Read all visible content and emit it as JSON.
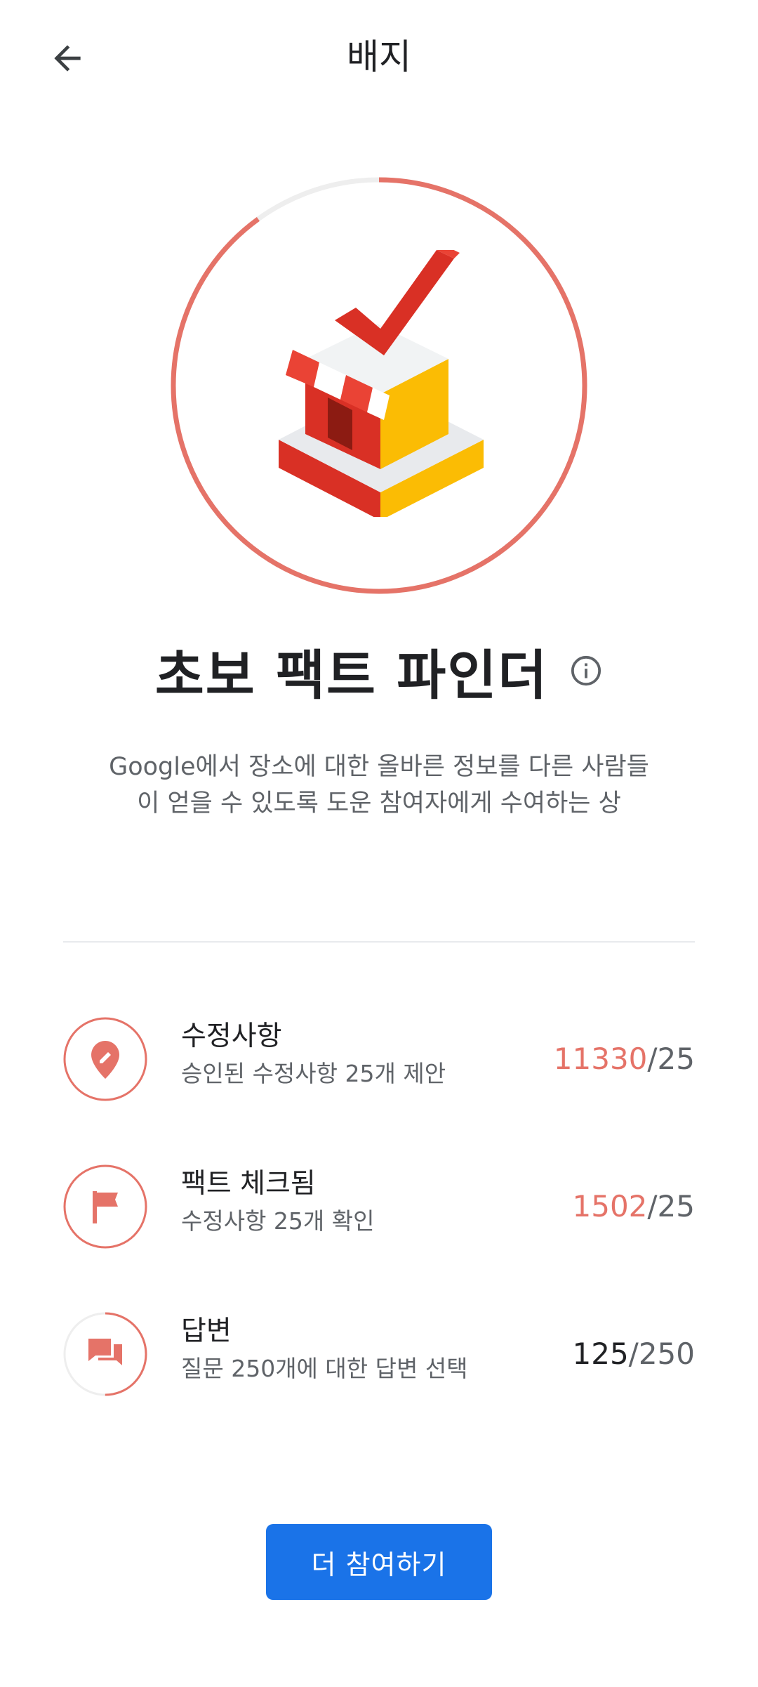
{
  "appbar": {
    "title": "배지",
    "back_icon": "arrow-back-icon"
  },
  "badge": {
    "name": "초보 팩트 파인더",
    "info_icon": "info-icon",
    "description": "Google에서 장소에 대한 올바른 정보를 다른 사람들이 얻을 수 있도록 도운 참여자에게 수여하는 상",
    "progress_fraction": 0.9,
    "ring_color": "#e57368",
    "ring_track_color": "#eeeeee"
  },
  "requirements": [
    {
      "icon": "pencil-pin-icon",
      "title": "수정사항",
      "subtitle": "승인된 수정사항 25개 제안",
      "current": "11330",
      "separator": "/",
      "goal": "25",
      "complete": true
    },
    {
      "icon": "flag-icon",
      "title": "팩트 체크됨",
      "subtitle": "수정사항 25개 확인",
      "current": "1502",
      "separator": "/",
      "goal": "25",
      "complete": true
    },
    {
      "icon": "chat-bubbles-icon",
      "title": "답변",
      "subtitle": "질문 250개에 대한 답변 선택",
      "current": "125",
      "separator": "/",
      "goal": "250",
      "complete": false,
      "progress_fraction": 0.5
    }
  ],
  "cta": {
    "label": "더 참여하기",
    "color": "#1a73e8"
  }
}
